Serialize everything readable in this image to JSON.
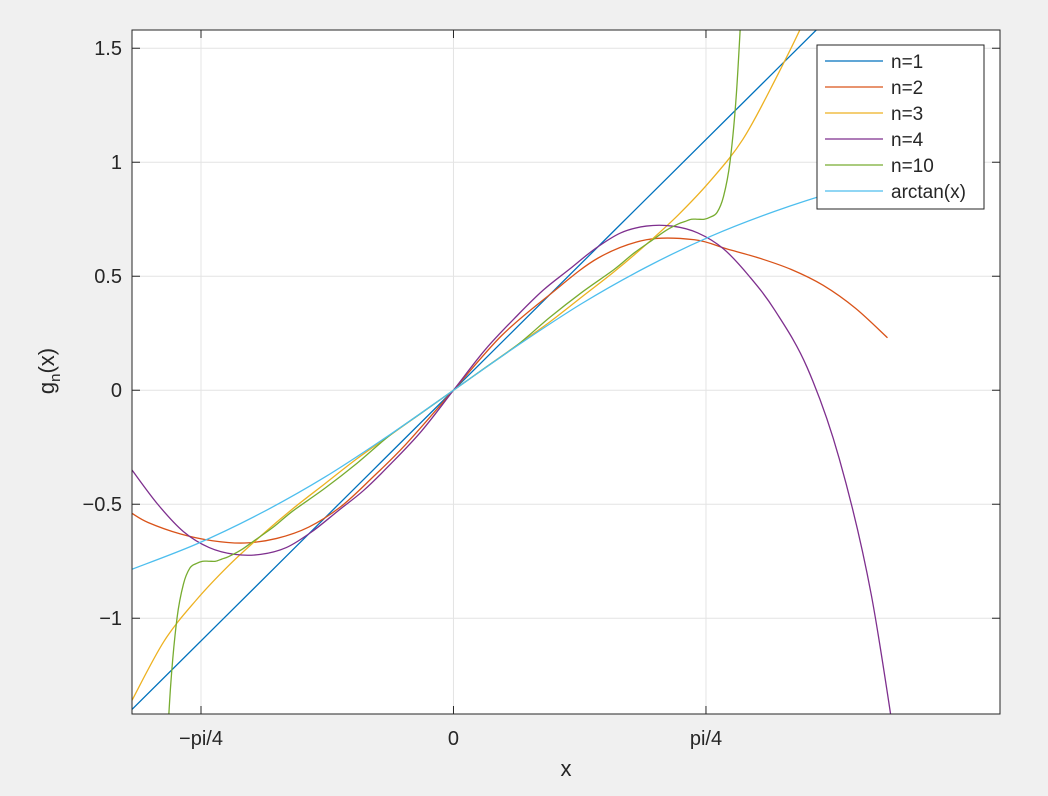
{
  "chart_data": {
    "type": "line",
    "title": "",
    "xlabel": "x",
    "ylabel": {
      "base": "g",
      "sub": "n",
      "tail": "(x)"
    },
    "xlim": [
      -1.0,
      1.7
    ],
    "ylim": [
      -1.42,
      1.58
    ],
    "x_ticks": [
      {
        "value": -0.785398,
        "label": "-pi/4"
      },
      {
        "value": 0,
        "label": "0"
      },
      {
        "value": 0.785398,
        "label": "pi/4"
      }
    ],
    "y_ticks": [
      {
        "value": 1.5,
        "label": "1.5"
      },
      {
        "value": 1,
        "label": "1"
      },
      {
        "value": 0.5,
        "label": "0.5"
      },
      {
        "value": 0,
        "label": "0"
      },
      {
        "value": -0.5,
        "label": "-0.5"
      },
      {
        "value": -1,
        "label": "-1"
      }
    ],
    "grid": true,
    "legend_position": "top-right",
    "series": [
      {
        "name": "n=1",
        "color": "#0072BD",
        "x": [
          -1.0,
          -0.5,
          0,
          0.5,
          1.0,
          1.35
        ],
        "y": [
          -1.4,
          -0.7,
          0,
          0.7,
          1.4,
          1.89
        ]
      },
      {
        "name": "n=2",
        "color": "#D95319",
        "x": [
          -1.0,
          -0.95,
          -0.85,
          -0.75,
          -0.65,
          -0.55,
          -0.45,
          -0.35,
          -0.25,
          -0.15,
          0,
          0.15,
          0.3,
          0.45,
          0.6,
          0.75,
          0.85,
          0.95,
          1.05,
          1.15,
          1.25,
          1.35
        ],
        "y": [
          -0.54,
          -0.58,
          -0.63,
          -0.66,
          -0.67,
          -0.65,
          -0.6,
          -0.51,
          -0.38,
          -0.24,
          0,
          0.24,
          0.42,
          0.58,
          0.66,
          0.66,
          0.62,
          0.58,
          0.53,
          0.46,
          0.36,
          0.23
        ]
      },
      {
        "name": "n=3",
        "color": "#EDB120",
        "x": [
          -1.0,
          -0.9,
          -0.8,
          -0.7,
          -0.6,
          -0.5,
          -0.4,
          -0.3,
          -0.2,
          -0.1,
          0,
          0.1,
          0.2,
          0.3,
          0.4,
          0.5,
          0.6,
          0.7,
          0.8,
          0.9,
          1.0,
          1.1,
          1.2,
          1.3
        ],
        "y": [
          -1.36,
          -1.1,
          -0.92,
          -0.77,
          -0.64,
          -0.52,
          -0.41,
          -0.3,
          -0.2,
          -0.1,
          0,
          0.1,
          0.2,
          0.3,
          0.41,
          0.52,
          0.64,
          0.77,
          0.92,
          1.1,
          1.36,
          1.65,
          2.0,
          2.4
        ]
      },
      {
        "name": "n=4",
        "color": "#7E2F8E",
        "x": [
          -1.0,
          -0.92,
          -0.84,
          -0.76,
          -0.68,
          -0.6,
          -0.52,
          -0.44,
          -0.36,
          -0.28,
          -0.2,
          -0.1,
          0,
          0.1,
          0.2,
          0.28,
          0.36,
          0.44,
          0.52,
          0.6,
          0.68,
          0.76,
          0.84,
          0.92,
          1.0,
          1.1,
          1.2,
          1.3,
          1.4
        ],
        "y": [
          -0.35,
          -0.5,
          -0.62,
          -0.69,
          -0.72,
          -0.72,
          -0.69,
          -0.62,
          -0.53,
          -0.44,
          -0.33,
          -0.18,
          0,
          0.18,
          0.33,
          0.44,
          0.53,
          0.62,
          0.69,
          0.72,
          0.72,
          0.69,
          0.62,
          0.5,
          0.35,
          0.1,
          -0.3,
          -0.9,
          -1.8
        ]
      },
      {
        "name": "n=10",
        "color": "#77AC30",
        "x": [
          -0.9,
          -0.88,
          -0.86,
          -0.84,
          -0.82,
          -0.8,
          -0.78,
          -0.76,
          -0.74,
          -0.72,
          -0.7,
          -0.66,
          -0.62,
          -0.56,
          -0.5,
          -0.4,
          -0.3,
          -0.2,
          -0.1,
          0,
          0.1,
          0.2,
          0.3,
          0.4,
          0.5,
          0.56,
          0.62,
          0.66,
          0.7,
          0.72,
          0.74,
          0.76,
          0.78,
          0.8,
          0.82,
          0.84,
          0.86,
          0.88,
          0.9
        ],
        "y": [
          -1.8,
          -1.3,
          -1.0,
          -0.85,
          -0.78,
          -0.76,
          -0.75,
          -0.75,
          -0.75,
          -0.74,
          -0.73,
          -0.7,
          -0.66,
          -0.6,
          -0.53,
          -0.43,
          -0.32,
          -0.2,
          -0.1,
          0,
          0.1,
          0.2,
          0.32,
          0.43,
          0.53,
          0.6,
          0.66,
          0.7,
          0.73,
          0.74,
          0.75,
          0.75,
          0.75,
          0.76,
          0.78,
          0.85,
          1.0,
          1.3,
          1.8
        ]
      },
      {
        "name": "arctan(x)",
        "color": "#4DBEEE",
        "x": [
          -1.0,
          -0.8,
          -0.6,
          -0.4,
          -0.2,
          0,
          0.2,
          0.4,
          0.6,
          0.8,
          1.0,
          1.2,
          1.4
        ],
        "y": [
          -0.785,
          -0.675,
          -0.54,
          -0.381,
          -0.197,
          0,
          0.197,
          0.381,
          0.54,
          0.675,
          0.785,
          0.876,
          0.951
        ]
      }
    ]
  }
}
